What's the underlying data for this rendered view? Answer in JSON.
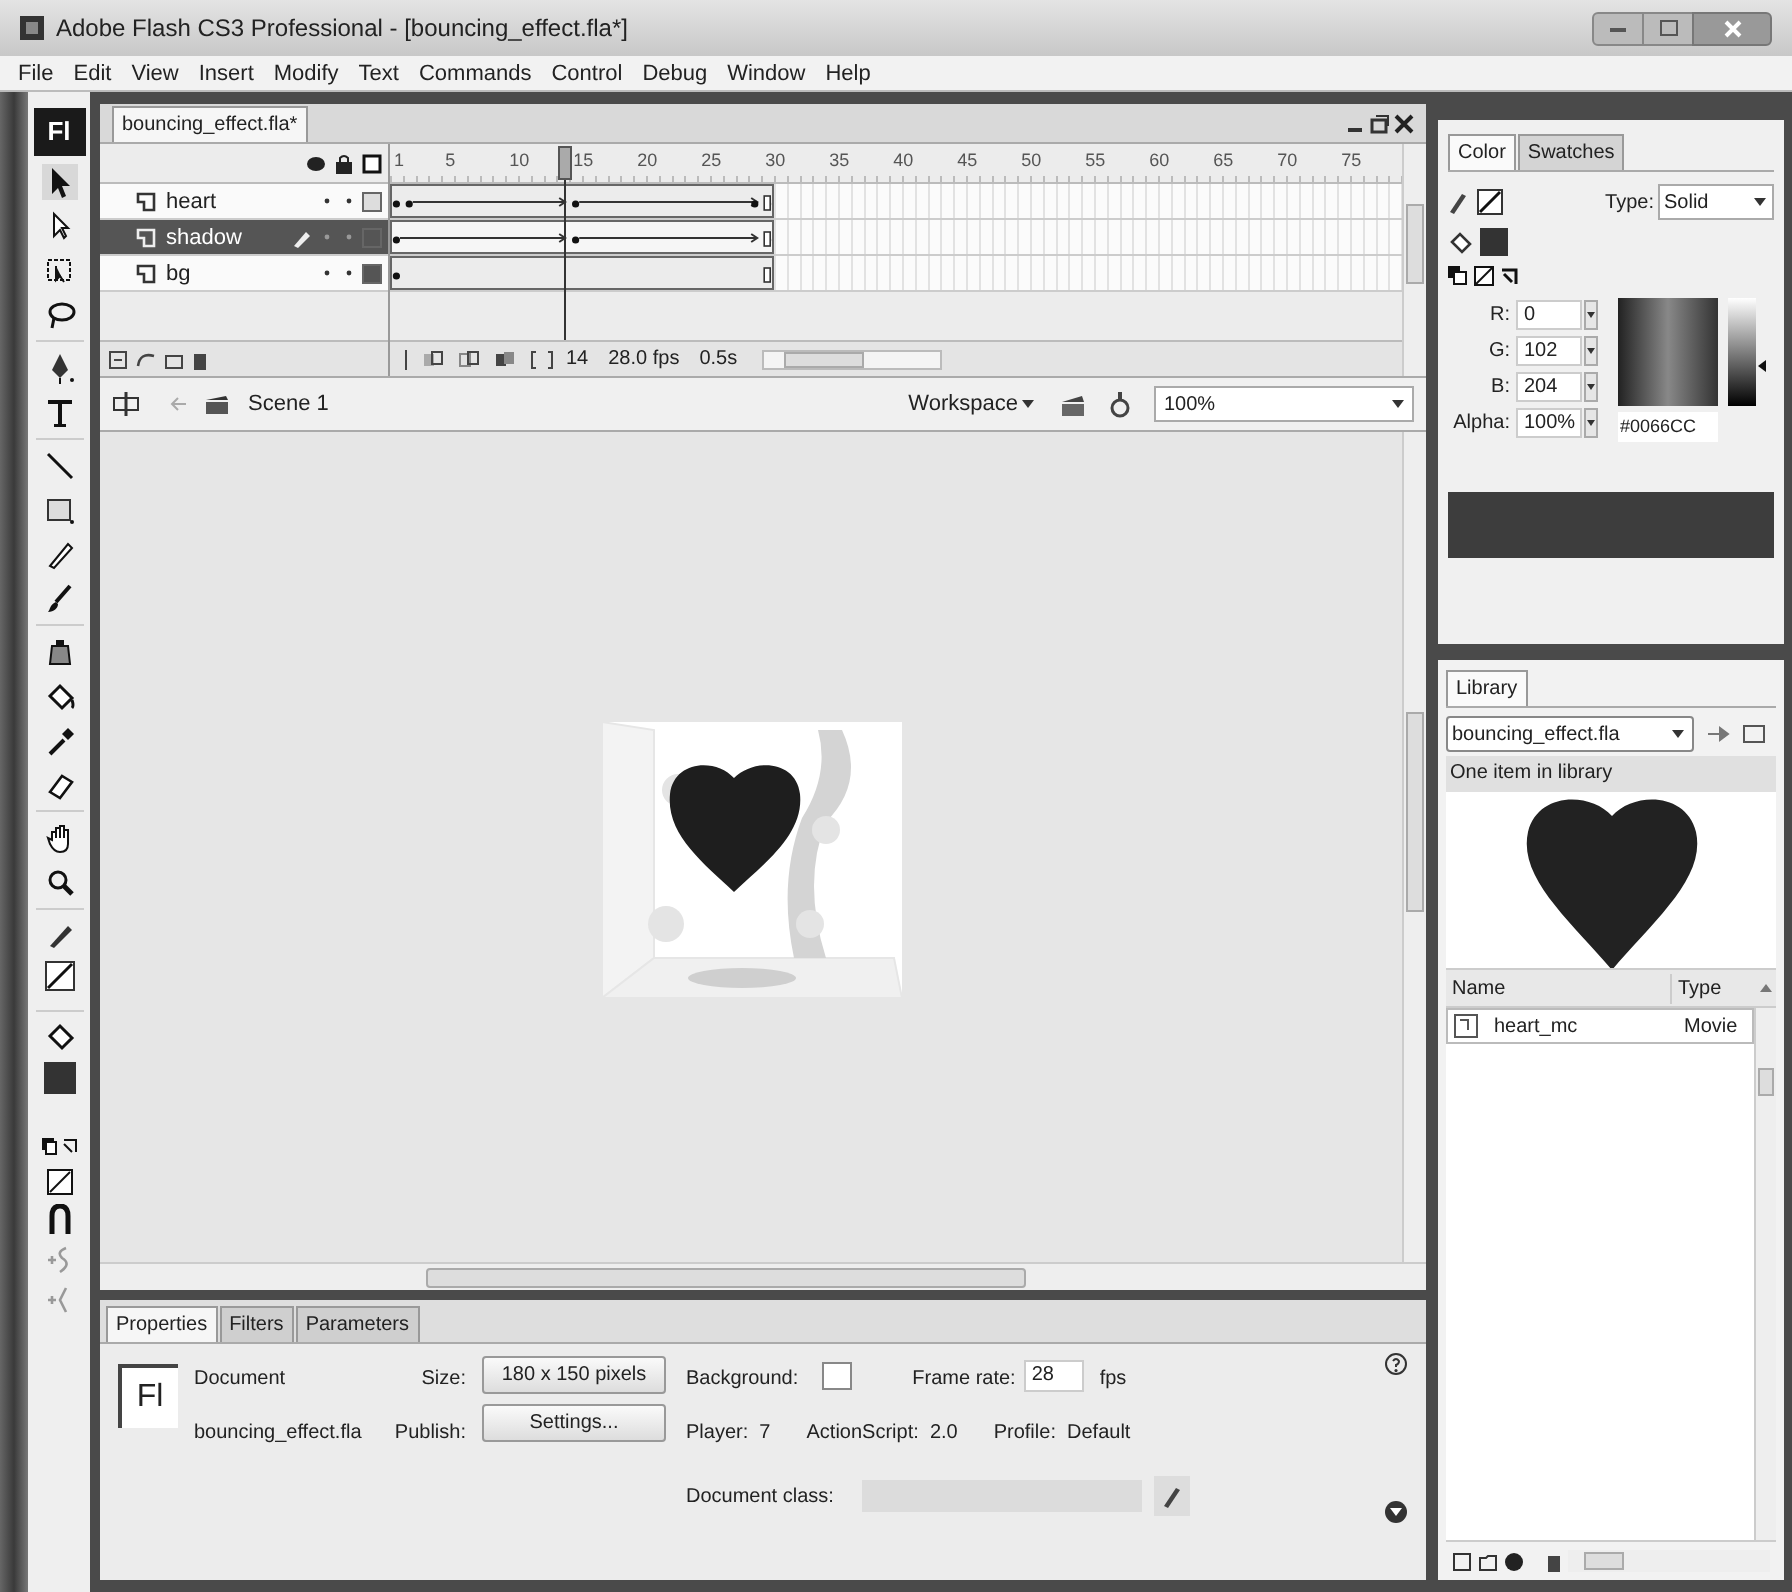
{
  "window": {
    "title": "Adobe Flash CS3 Professional - [bouncing_effect.fla*]"
  },
  "menu": [
    "File",
    "Edit",
    "View",
    "Insert",
    "Modify",
    "Text",
    "Commands",
    "Control",
    "Debug",
    "Window",
    "Help"
  ],
  "tools": {
    "logo": "Fl"
  },
  "document_tabs": [
    {
      "label": "bouncing_effect.fla*",
      "selected": true
    }
  ],
  "timeline": {
    "frame_labels": [
      "1",
      "5",
      "10",
      "15",
      "20",
      "25",
      "30",
      "35",
      "40",
      "45",
      "50",
      "55",
      "60",
      "65",
      "70",
      "75"
    ],
    "layers": [
      {
        "name": "heart",
        "selected": false,
        "editing": false
      },
      {
        "name": "shadow",
        "selected": true,
        "editing": true
      },
      {
        "name": "bg",
        "selected": false,
        "editing": false
      }
    ],
    "status": {
      "frame": "14",
      "fps": "28.0 fps",
      "time": "0.5s"
    }
  },
  "edit_bar": {
    "scene": "Scene 1",
    "workspace": "Workspace",
    "zoom": "100%"
  },
  "color_panel": {
    "tabs": [
      {
        "label": "Color",
        "selected": true
      },
      {
        "label": "Swatches",
        "selected": false
      }
    ],
    "type_label": "Type:",
    "type_value": "Solid",
    "channels": [
      {
        "label": "R:",
        "value": "0"
      },
      {
        "label": "G:",
        "value": "102"
      },
      {
        "label": "B:",
        "value": "204"
      },
      {
        "label": "Alpha:",
        "value": "100%"
      }
    ],
    "hex": "#0066CC",
    "brightness": {
      "level": 0.35
    }
  },
  "library": {
    "tabs": [
      {
        "label": "Library",
        "selected": true
      }
    ],
    "document": "bouncing_effect.fla",
    "count_text": "One item in library",
    "columns": [
      "Name",
      "Type"
    ],
    "items": [
      {
        "name": "heart_mc",
        "type": "Movie"
      }
    ]
  },
  "properties": {
    "tabs": [
      {
        "label": "Properties",
        "selected": true
      },
      {
        "label": "Filters",
        "selected": false
      },
      {
        "label": "Parameters",
        "selected": false
      }
    ],
    "logo": "Fl",
    "kind": "Document",
    "file_name": "bouncing_effect.fla",
    "size_label": "Size:",
    "size_button": "180 x 150 pixels",
    "publish_label": "Publish:",
    "settings_button": "Settings...",
    "background_label": "Background:",
    "frame_rate_label": "Frame rate:",
    "frame_rate": "28",
    "fps_unit": "fps",
    "player": "Player:  7",
    "actionscript": "ActionScript:  2.0",
    "profile": "Profile:  Default",
    "document_class_label": "Document class:"
  }
}
